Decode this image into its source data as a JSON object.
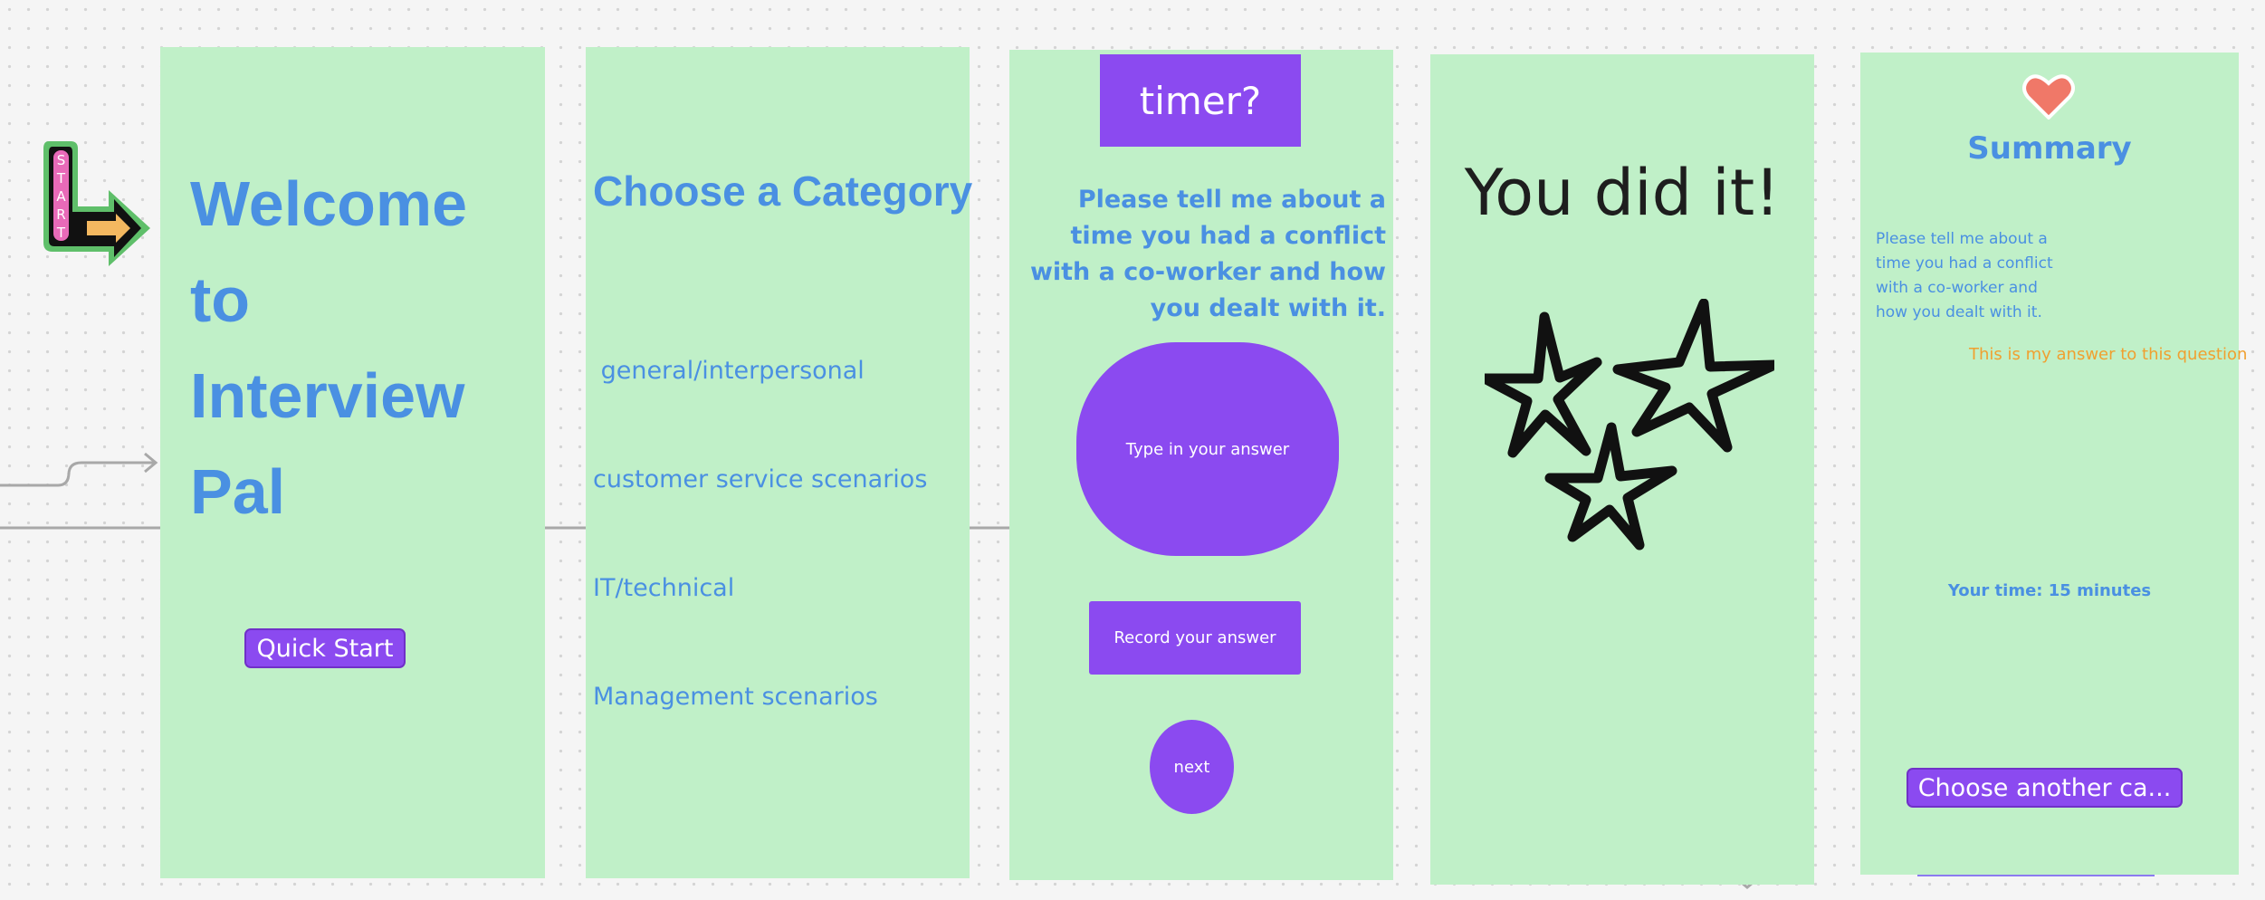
{
  "colors": {
    "canvas": "#f5f5f5",
    "frame": "#c0f0c8",
    "accent_blue": "#4a90e2",
    "accent_purple": "#8b4af0",
    "answer_orange": "#f0a030",
    "heart": "#f07868",
    "connector": "#a8a8a8"
  },
  "sticker": {
    "letters": [
      "S",
      "T",
      "A",
      "R",
      "T"
    ]
  },
  "welcome": {
    "title_lines": [
      "Welcome",
      "to",
      "Interview",
      "Pal"
    ],
    "quick_start": "Quick Start"
  },
  "category": {
    "title": "Choose a Category",
    "options": [
      " general/interpersonal",
      "customer service scenarios",
      "IT/technical",
      "Management scenarios"
    ]
  },
  "question": {
    "timer_label": "timer?",
    "question_text": "Please tell me about a time you had a conflict with a co-worker and how you dealt with it.",
    "answer_placeholder": "Type in your answer",
    "record_label": "Record your answer",
    "next_label": "next"
  },
  "done": {
    "title": "You did it!",
    "stars_icon": "hand-drawn-stars"
  },
  "summary": {
    "icon": "heart-icon",
    "title": "Summary",
    "question_text": "Please tell me about a time you had a conflict with a co-worker and how you dealt with it.",
    "answer_text": "This is my answer to this question",
    "time_text": "Your time: 15 minutes",
    "choose_another": "Choose another ca..."
  }
}
